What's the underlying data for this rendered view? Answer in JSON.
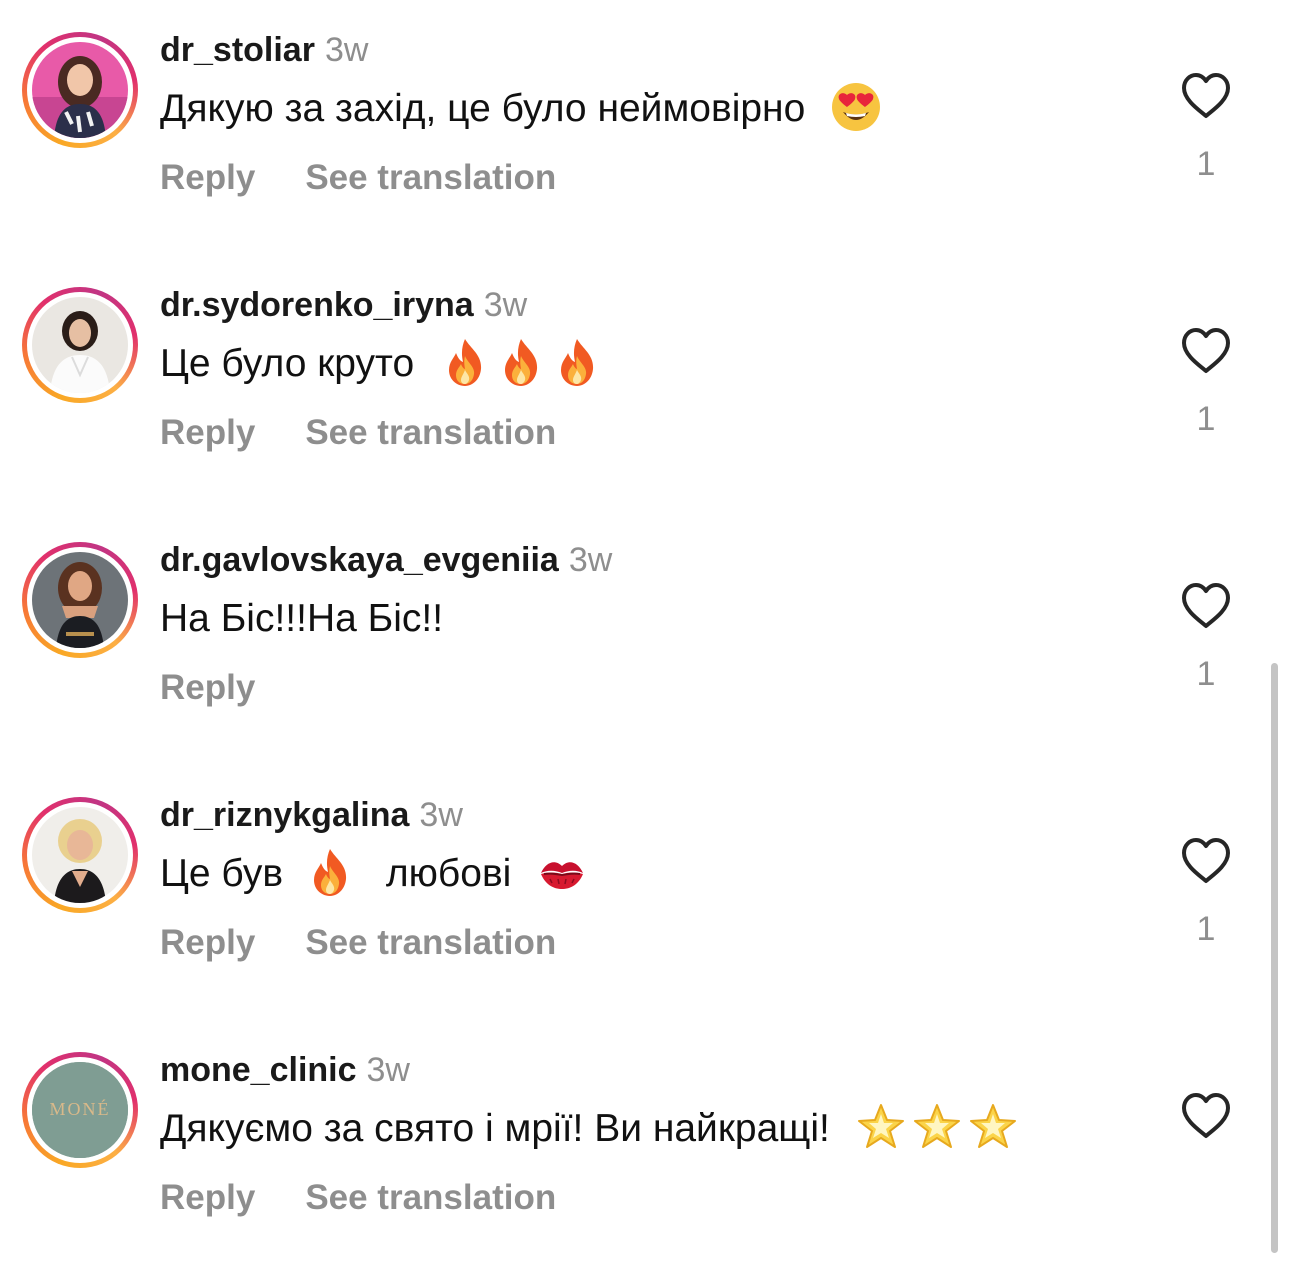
{
  "colors": {
    "muted": "#8e8e8e",
    "text": "#111111",
    "ring_gradient": [
      "#f9a825",
      "#f77737",
      "#e1306c",
      "#c13584"
    ]
  },
  "actions": {
    "reply_label": "Reply",
    "translate_label": "See translation"
  },
  "comments": [
    {
      "username": "dr_stoliar",
      "time": "3w",
      "text": "Дякую за захід, це було неймовірно",
      "emojis": [
        "heart-eyes-emoji"
      ],
      "likes": "1",
      "has_translation": true
    },
    {
      "username": "dr.sydorenko_iryna",
      "time": "3w",
      "text": "Це було круто",
      "emojis": [
        "fire-emoji",
        "fire-emoji",
        "fire-emoji"
      ],
      "likes": "1",
      "has_translation": true
    },
    {
      "username": "dr.gavlovskaya_evgeniia",
      "time": "3w",
      "text": "На Біс!!!На Біс!!",
      "emojis": [],
      "likes": "1",
      "has_translation": false
    },
    {
      "username": "dr_riznykgalina",
      "time": "3w",
      "text_before": "Це був",
      "text_after": "любові",
      "emojis": [
        "fire-emoji",
        "kiss-mark-emoji"
      ],
      "likes": "1",
      "has_translation": true
    },
    {
      "username": "mone_clinic",
      "time": "3w",
      "text": "Дякуємо за свято і мрії! Ви найкращі!",
      "emojis": [
        "glowing-star-emoji",
        "glowing-star-emoji",
        "glowing-star-emoji"
      ],
      "avatar_logo": "MONÉ",
      "likes": "",
      "has_translation": true
    }
  ]
}
